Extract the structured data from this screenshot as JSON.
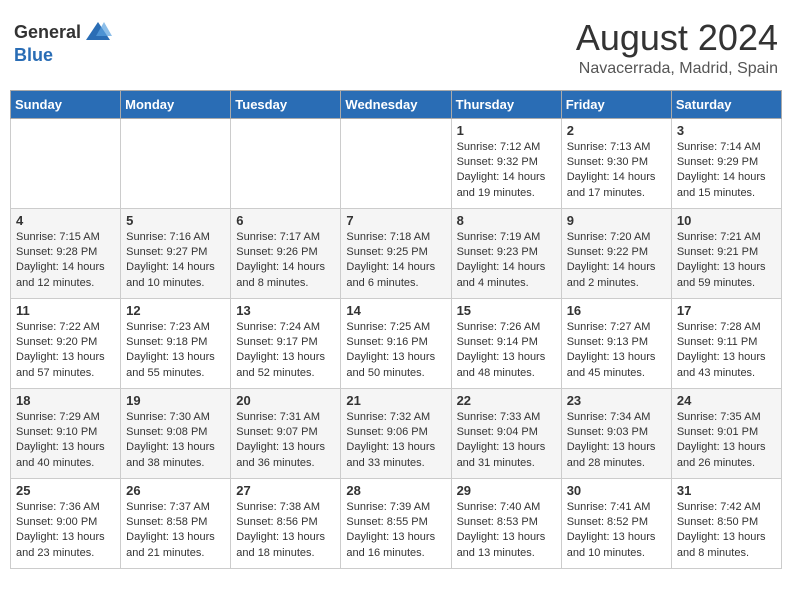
{
  "header": {
    "logo_general": "General",
    "logo_blue": "Blue",
    "month_year": "August 2024",
    "location": "Navacerrada, Madrid, Spain"
  },
  "days_of_week": [
    "Sunday",
    "Monday",
    "Tuesday",
    "Wednesday",
    "Thursday",
    "Friday",
    "Saturday"
  ],
  "weeks": [
    [
      {
        "day": "",
        "info": ""
      },
      {
        "day": "",
        "info": ""
      },
      {
        "day": "",
        "info": ""
      },
      {
        "day": "",
        "info": ""
      },
      {
        "day": "1",
        "info": "Sunrise: 7:12 AM\nSunset: 9:32 PM\nDaylight: 14 hours\nand 19 minutes."
      },
      {
        "day": "2",
        "info": "Sunrise: 7:13 AM\nSunset: 9:30 PM\nDaylight: 14 hours\nand 17 minutes."
      },
      {
        "day": "3",
        "info": "Sunrise: 7:14 AM\nSunset: 9:29 PM\nDaylight: 14 hours\nand 15 minutes."
      }
    ],
    [
      {
        "day": "4",
        "info": "Sunrise: 7:15 AM\nSunset: 9:28 PM\nDaylight: 14 hours\nand 12 minutes."
      },
      {
        "day": "5",
        "info": "Sunrise: 7:16 AM\nSunset: 9:27 PM\nDaylight: 14 hours\nand 10 minutes."
      },
      {
        "day": "6",
        "info": "Sunrise: 7:17 AM\nSunset: 9:26 PM\nDaylight: 14 hours\nand 8 minutes."
      },
      {
        "day": "7",
        "info": "Sunrise: 7:18 AM\nSunset: 9:25 PM\nDaylight: 14 hours\nand 6 minutes."
      },
      {
        "day": "8",
        "info": "Sunrise: 7:19 AM\nSunset: 9:23 PM\nDaylight: 14 hours\nand 4 minutes."
      },
      {
        "day": "9",
        "info": "Sunrise: 7:20 AM\nSunset: 9:22 PM\nDaylight: 14 hours\nand 2 minutes."
      },
      {
        "day": "10",
        "info": "Sunrise: 7:21 AM\nSunset: 9:21 PM\nDaylight: 13 hours\nand 59 minutes."
      }
    ],
    [
      {
        "day": "11",
        "info": "Sunrise: 7:22 AM\nSunset: 9:20 PM\nDaylight: 13 hours\nand 57 minutes."
      },
      {
        "day": "12",
        "info": "Sunrise: 7:23 AM\nSunset: 9:18 PM\nDaylight: 13 hours\nand 55 minutes."
      },
      {
        "day": "13",
        "info": "Sunrise: 7:24 AM\nSunset: 9:17 PM\nDaylight: 13 hours\nand 52 minutes."
      },
      {
        "day": "14",
        "info": "Sunrise: 7:25 AM\nSunset: 9:16 PM\nDaylight: 13 hours\nand 50 minutes."
      },
      {
        "day": "15",
        "info": "Sunrise: 7:26 AM\nSunset: 9:14 PM\nDaylight: 13 hours\nand 48 minutes."
      },
      {
        "day": "16",
        "info": "Sunrise: 7:27 AM\nSunset: 9:13 PM\nDaylight: 13 hours\nand 45 minutes."
      },
      {
        "day": "17",
        "info": "Sunrise: 7:28 AM\nSunset: 9:11 PM\nDaylight: 13 hours\nand 43 minutes."
      }
    ],
    [
      {
        "day": "18",
        "info": "Sunrise: 7:29 AM\nSunset: 9:10 PM\nDaylight: 13 hours\nand 40 minutes."
      },
      {
        "day": "19",
        "info": "Sunrise: 7:30 AM\nSunset: 9:08 PM\nDaylight: 13 hours\nand 38 minutes."
      },
      {
        "day": "20",
        "info": "Sunrise: 7:31 AM\nSunset: 9:07 PM\nDaylight: 13 hours\nand 36 minutes."
      },
      {
        "day": "21",
        "info": "Sunrise: 7:32 AM\nSunset: 9:06 PM\nDaylight: 13 hours\nand 33 minutes."
      },
      {
        "day": "22",
        "info": "Sunrise: 7:33 AM\nSunset: 9:04 PM\nDaylight: 13 hours\nand 31 minutes."
      },
      {
        "day": "23",
        "info": "Sunrise: 7:34 AM\nSunset: 9:03 PM\nDaylight: 13 hours\nand 28 minutes."
      },
      {
        "day": "24",
        "info": "Sunrise: 7:35 AM\nSunset: 9:01 PM\nDaylight: 13 hours\nand 26 minutes."
      }
    ],
    [
      {
        "day": "25",
        "info": "Sunrise: 7:36 AM\nSunset: 9:00 PM\nDaylight: 13 hours\nand 23 minutes."
      },
      {
        "day": "26",
        "info": "Sunrise: 7:37 AM\nSunset: 8:58 PM\nDaylight: 13 hours\nand 21 minutes."
      },
      {
        "day": "27",
        "info": "Sunrise: 7:38 AM\nSunset: 8:56 PM\nDaylight: 13 hours\nand 18 minutes."
      },
      {
        "day": "28",
        "info": "Sunrise: 7:39 AM\nSunset: 8:55 PM\nDaylight: 13 hours\nand 16 minutes."
      },
      {
        "day": "29",
        "info": "Sunrise: 7:40 AM\nSunset: 8:53 PM\nDaylight: 13 hours\nand 13 minutes."
      },
      {
        "day": "30",
        "info": "Sunrise: 7:41 AM\nSunset: 8:52 PM\nDaylight: 13 hours\nand 10 minutes."
      },
      {
        "day": "31",
        "info": "Sunrise: 7:42 AM\nSunset: 8:50 PM\nDaylight: 13 hours\nand 8 minutes."
      }
    ]
  ]
}
